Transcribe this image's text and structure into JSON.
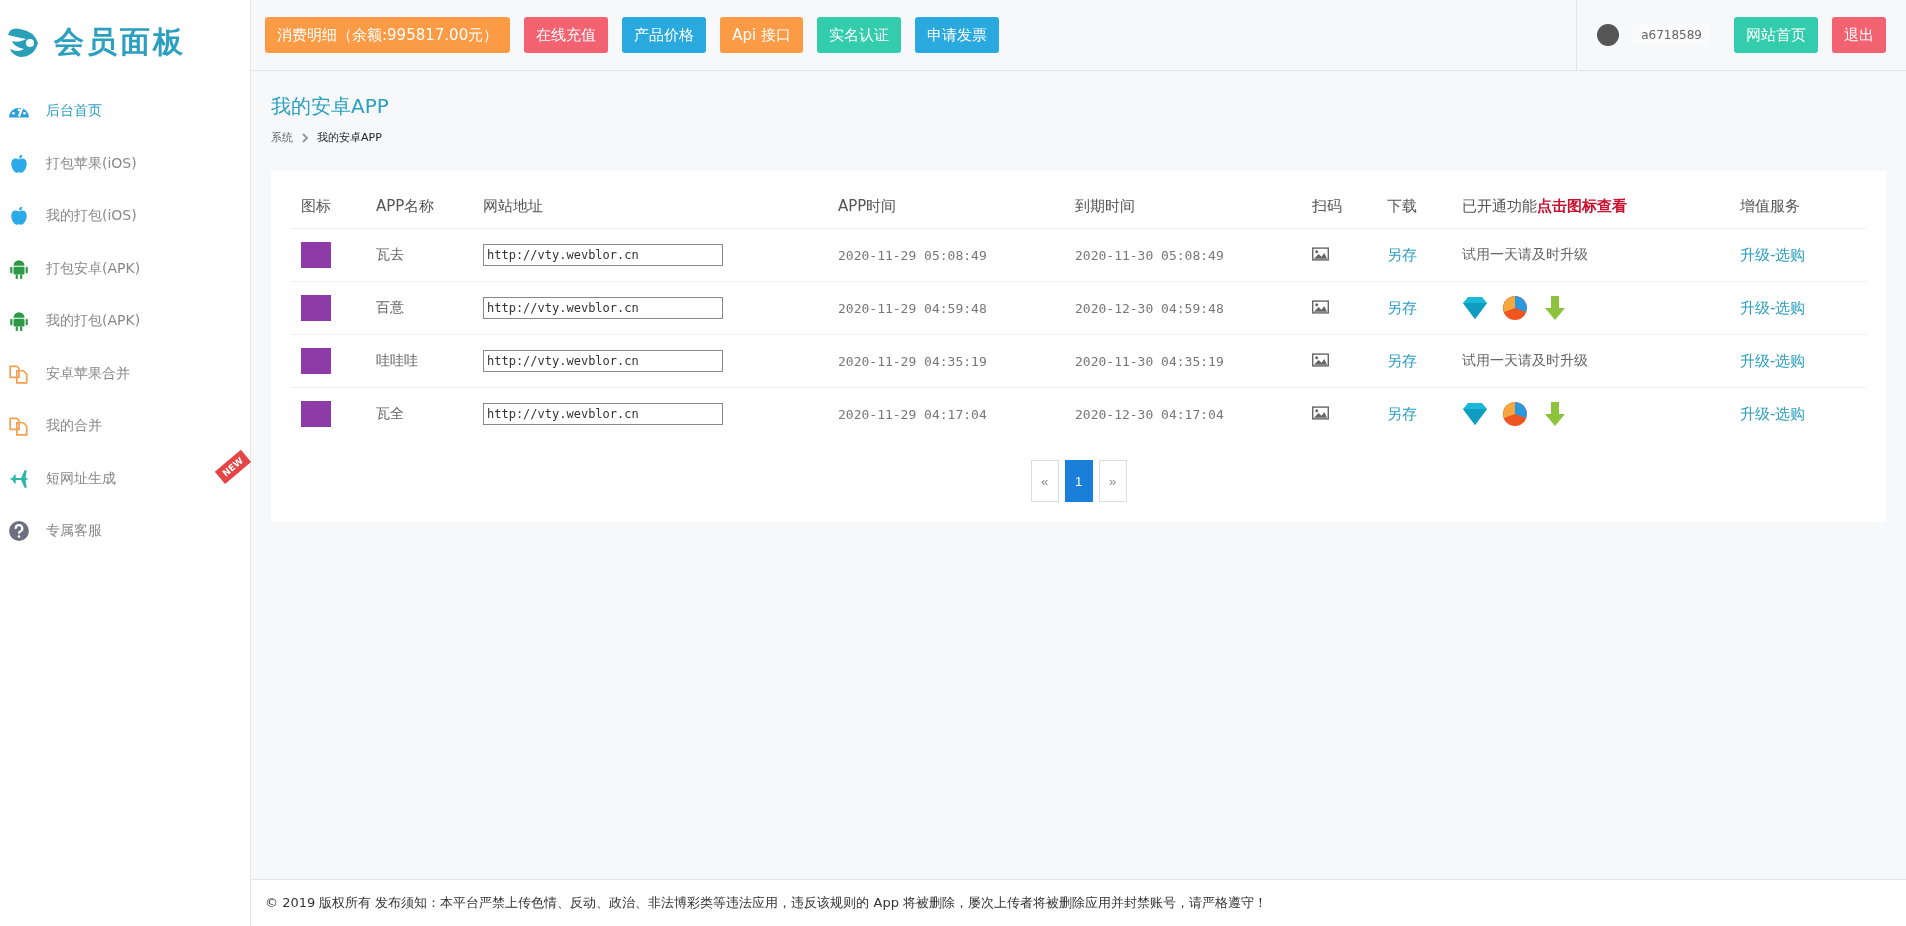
{
  "logo": {
    "title": "会员面板"
  },
  "top_buttons": [
    {
      "label": "消费明细（余额:995817.00元）",
      "color": "#fc9b46"
    },
    {
      "label": "在线充值",
      "color": "#f26271"
    },
    {
      "label": "产品价格",
      "color": "#2aa9df"
    },
    {
      "label": "Api 接口",
      "color": "#fc9b46"
    },
    {
      "label": "实名认证",
      "color": "#33ccac"
    },
    {
      "label": "申请发票",
      "color": "#2aa9df"
    }
  ],
  "user": {
    "name": "a6718589"
  },
  "right_buttons": [
    {
      "label": "网站首页",
      "color": "#33ccac"
    },
    {
      "label": "退出",
      "color": "#f26271"
    }
  ],
  "sidebar": {
    "items": [
      {
        "label": "后台首页",
        "kind": "dashboard",
        "selected": true
      },
      {
        "label": "打包苹果(iOS)",
        "kind": "apple",
        "selected": false
      },
      {
        "label": "我的打包(iOS)",
        "kind": "apple",
        "selected": false
      },
      {
        "label": "打包安卓(APK)",
        "kind": "android",
        "selected": false
      },
      {
        "label": "我的打包(APK)",
        "kind": "android",
        "selected": false
      },
      {
        "label": "安卓苹果合并",
        "kind": "merge",
        "selected": false
      },
      {
        "label": "我的合并",
        "kind": "merge",
        "selected": false
      },
      {
        "label": "短网址生成",
        "kind": "plane",
        "selected": false,
        "badge": "NEW"
      },
      {
        "label": "专属客服",
        "kind": "help",
        "selected": false
      }
    ]
  },
  "page": {
    "title": "我的安卓APP",
    "breadcrumb": [
      "系统",
      "我的安卓APP"
    ]
  },
  "table": {
    "columns": [
      "图标",
      "APP名称",
      "网站地址",
      "APP时间",
      "到期时间",
      "扫码",
      "下载",
      "已开通功能**点击图标查看**",
      "增值服务"
    ],
    "rows": [
      {
        "name": "瓦去",
        "url": "http://vty.wevblor.cn",
        "app_time": "2020-11-29 05:08:49",
        "expire_time": "2020-11-30 05:08:49",
        "download": "另存",
        "features": {
          "kind": "text",
          "text": "试用一天请及时升级"
        },
        "service": "升级-选购"
      },
      {
        "name": "百意",
        "url": "http://vty.wevblor.cn",
        "app_time": "2020-11-29 04:59:48",
        "expire_time": "2020-12-30 04:59:48",
        "download": "另存",
        "features": {
          "kind": "icons"
        },
        "service": "升级-选购"
      },
      {
        "name": "哇哇哇",
        "url": "http://vty.wevblor.cn",
        "app_time": "2020-11-29 04:35:19",
        "expire_time": "2020-11-30 04:35:19",
        "download": "另存",
        "features": {
          "kind": "text",
          "text": "试用一天请及时升级"
        },
        "service": "升级-选购"
      },
      {
        "name": "瓦全",
        "url": "http://vty.wevblor.cn",
        "app_time": "2020-11-29 04:17:04",
        "expire_time": "2020-12-30 04:17:04",
        "download": "另存",
        "features": {
          "kind": "icons"
        },
        "service": "升级-选购"
      }
    ]
  },
  "pagination": [
    {
      "label": "«",
      "selected": false
    },
    {
      "label": "1",
      "selected": true
    },
    {
      "label": "»",
      "selected": false
    }
  ],
  "footer": {
    "text": "© 2019 版权所有 发布须知：本平台严禁上传色情、反动、政治、非法博彩类等违法应用，违反该规则的 App 将被删除，屡次上传者将被删除应用并封禁账号，请严格遵守！"
  }
}
